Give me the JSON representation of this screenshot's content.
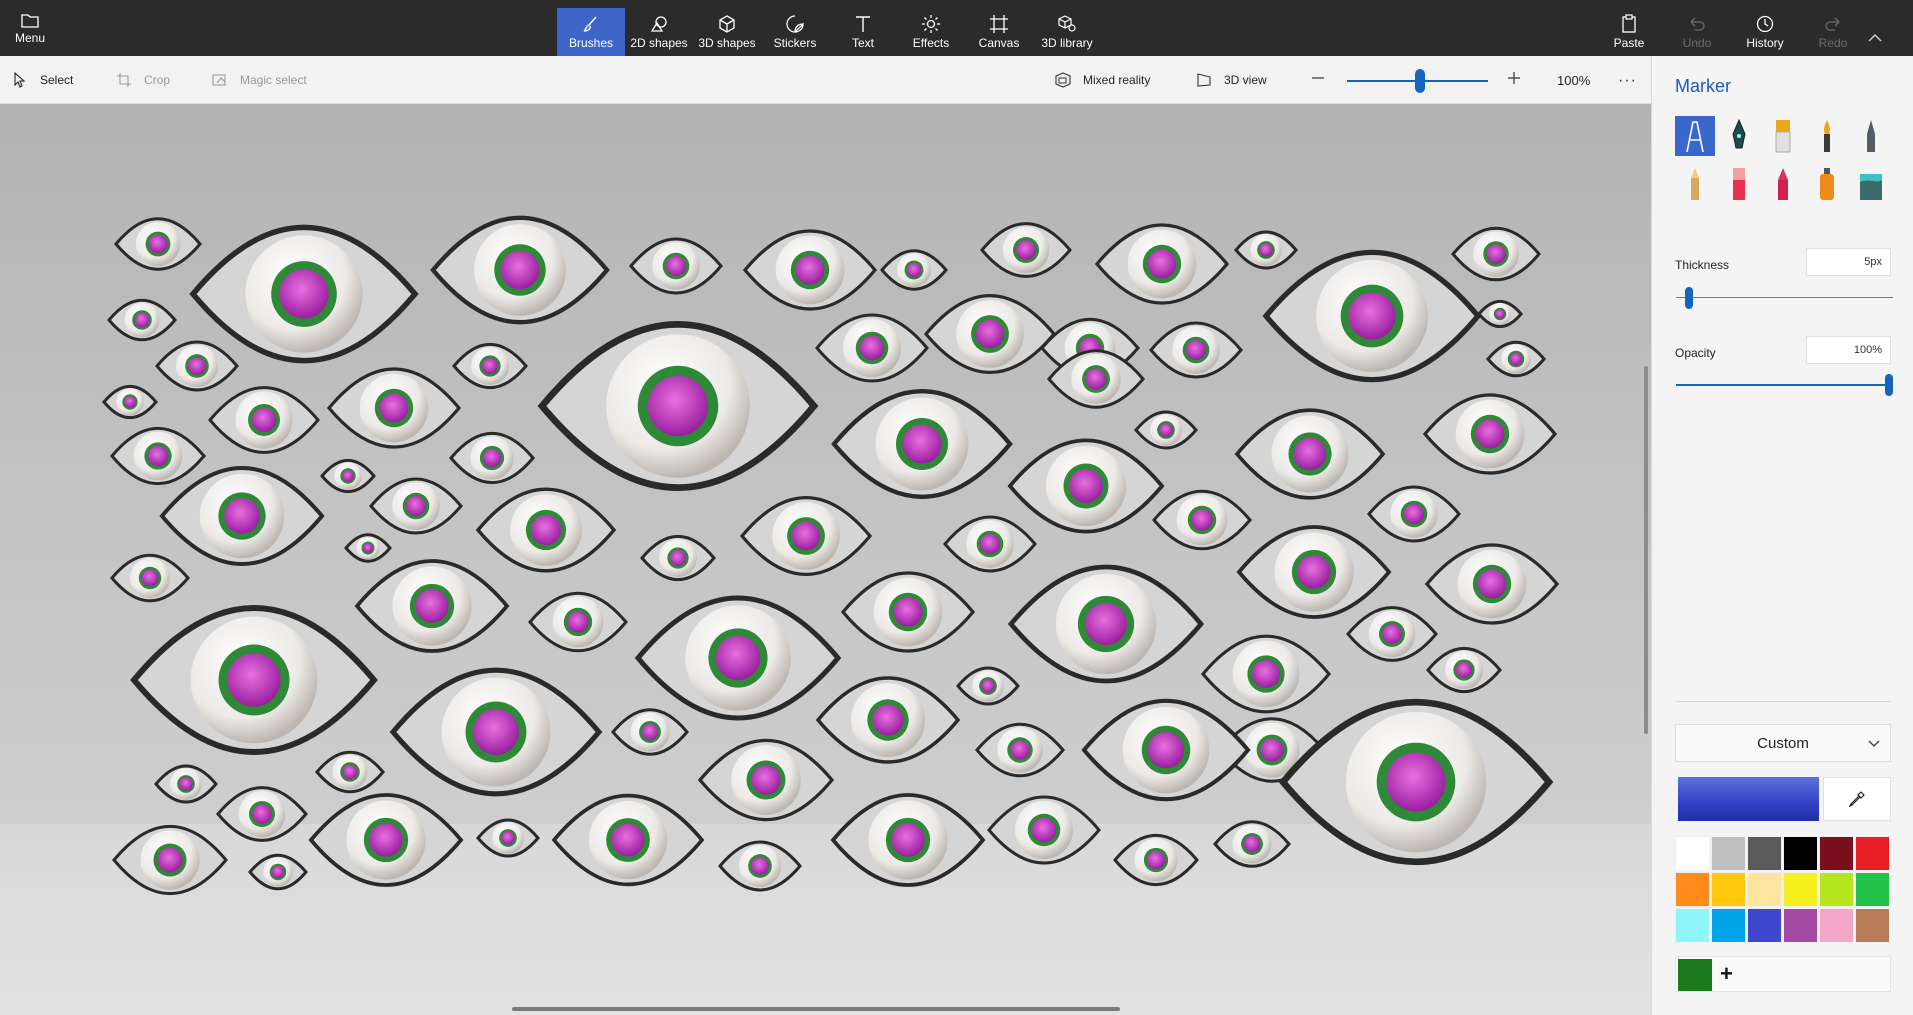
{
  "topbar": {
    "menu_label": "Menu",
    "tabs": [
      {
        "label": "Brushes",
        "icon": "brush-icon",
        "active": true
      },
      {
        "label": "2D shapes",
        "icon": "shapes-2d-icon"
      },
      {
        "label": "3D shapes",
        "icon": "cube-icon"
      },
      {
        "label": "Stickers",
        "icon": "sticker-icon"
      },
      {
        "label": "Text",
        "icon": "text-icon"
      },
      {
        "label": "Effects",
        "icon": "sun-icon"
      },
      {
        "label": "Canvas",
        "icon": "canvas-icon"
      },
      {
        "label": "3D library",
        "icon": "library-icon"
      }
    ],
    "actions": [
      {
        "label": "Paste",
        "icon": "paste-icon",
        "enabled": true
      },
      {
        "label": "Undo",
        "icon": "undo-icon",
        "enabled": false
      },
      {
        "label": "History",
        "icon": "history-icon",
        "enabled": true
      },
      {
        "label": "Redo",
        "icon": "redo-icon",
        "enabled": false
      }
    ]
  },
  "toolbar": {
    "select_label": "Select",
    "crop_label": "Crop",
    "magic_select_label": "Magic select",
    "mixed_reality_label": "Mixed reality",
    "view_3d_label": "3D view",
    "zoom_percent": "100%",
    "zoom_level": 0.52,
    "more_label": "···"
  },
  "panel": {
    "title": "Marker",
    "brushes": [
      {
        "name": "marker",
        "active": true
      },
      {
        "name": "calligraphy-pen"
      },
      {
        "name": "oil-brush"
      },
      {
        "name": "watercolor"
      },
      {
        "name": "pixel-pen"
      },
      {
        "name": "pencil"
      },
      {
        "name": "eraser"
      },
      {
        "name": "crayon"
      },
      {
        "name": "spray-can"
      },
      {
        "name": "fill-bucket"
      }
    ],
    "thickness_label": "Thickness",
    "thickness_value": "5px",
    "thickness_level": 0.03,
    "opacity_label": "Opacity",
    "opacity_value": "100%",
    "opacity_level": 1.0,
    "palette_dropdown": "Custom",
    "current_color": "#3140c4",
    "swatches": [
      "#ffffff",
      "#c0c0c0",
      "#5a5a5a",
      "#000000",
      "#7a0f1e",
      "#e81e25",
      "#ff8c1a",
      "#ffc90e",
      "#fde4a0",
      "#f5f01e",
      "#b5e61d",
      "#22c24b",
      "#8ff7f9",
      "#00a2e8",
      "#3f48cc",
      "#a349a4",
      "#f3a6c6",
      "#b97a57"
    ],
    "custom_swatch": "#1a7a1a",
    "add_label": "+"
  }
}
